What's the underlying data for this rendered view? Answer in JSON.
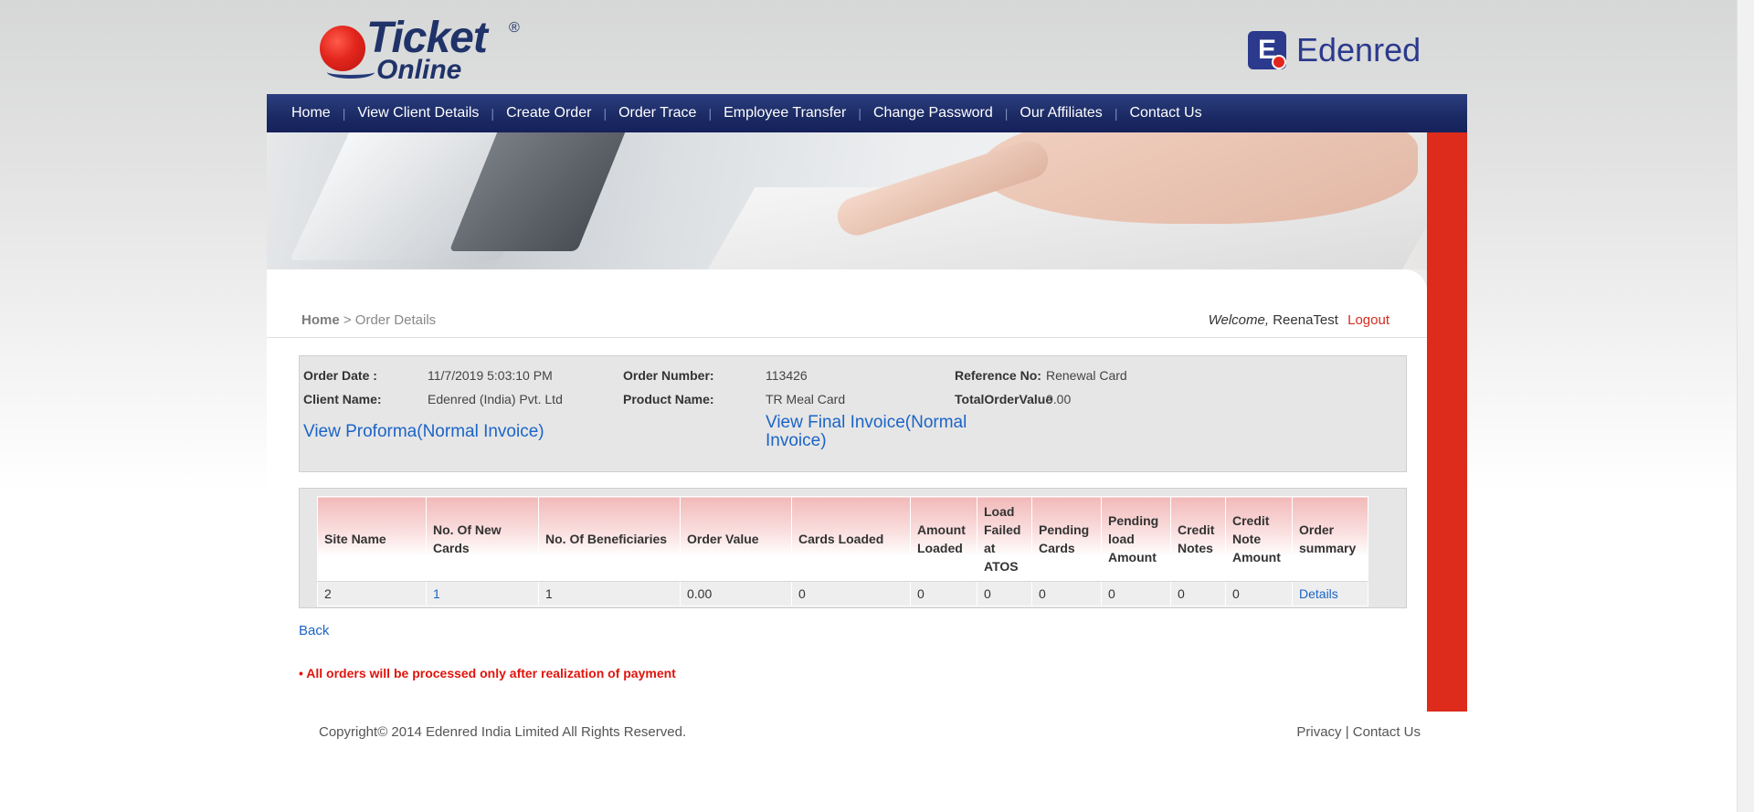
{
  "header": {
    "logo_ticket_word1": "Ticket",
    "logo_ticket_reg": "®",
    "logo_ticket_word2": "Online",
    "logo_edenred_badge": "E",
    "logo_edenred_text": "Edenred"
  },
  "nav": {
    "items": [
      {
        "label": "Home"
      },
      {
        "label": "View Client Details"
      },
      {
        "label": "Create Order"
      },
      {
        "label": "Order Trace"
      },
      {
        "label": "Employee Transfer"
      },
      {
        "label": "Change Password"
      },
      {
        "label": "Our Affiliates"
      },
      {
        "label": "Contact Us"
      }
    ],
    "separator": "|"
  },
  "breadcrumb": {
    "home": "Home",
    "separator": ">",
    "current": "Order Details"
  },
  "user": {
    "welcome": "Welcome,",
    "name": "ReenaTest",
    "logout": "Logout"
  },
  "order": {
    "order_date_label": "Order Date :",
    "order_date": "11/7/2019 5:03:10 PM",
    "order_number_label": "Order Number:",
    "order_number": "113426",
    "reference_label": "Reference No:",
    "reference": "Renewal Card",
    "client_name_label": "Client Name:",
    "client_name": "Edenred (India) Pvt. Ltd",
    "product_name_label": "Product Name:",
    "product_name": "TR Meal Card",
    "total_label": "TotalOrderValue",
    "total": "0.00",
    "proforma_link": "View Proforma(Normal Invoice)",
    "final_link": "View Final Invoice(Normal Invoice)"
  },
  "table": {
    "headers": [
      "Site Name",
      "No. Of New Cards",
      "No. Of Beneficiaries",
      "Order Value",
      "Cards Loaded",
      "Amount Loaded",
      "Load Failed at ATOS",
      "Pending Cards",
      "Pending load Amount",
      "Credit Notes",
      "Credit Note Amount",
      "Order summary"
    ],
    "rows": [
      [
        "2",
        "1",
        "1",
        "0.00",
        "0",
        "0",
        "0",
        "0",
        "0",
        "0",
        "0",
        "Details"
      ]
    ]
  },
  "back_link": "Back",
  "notice": "• All orders will be processed only after realization of payment",
  "footer": {
    "copyright": "Copyright© 2014 Edenred India Limited All Rights Reserved.",
    "privacy": "Privacy",
    "separator": "|",
    "contact": "Contact Us"
  },
  "colors": {
    "nav_bg": "#1b2a63",
    "accent_red": "#dd2b1c",
    "link_blue": "#1b64c6",
    "notice_red": "#e0140c"
  }
}
